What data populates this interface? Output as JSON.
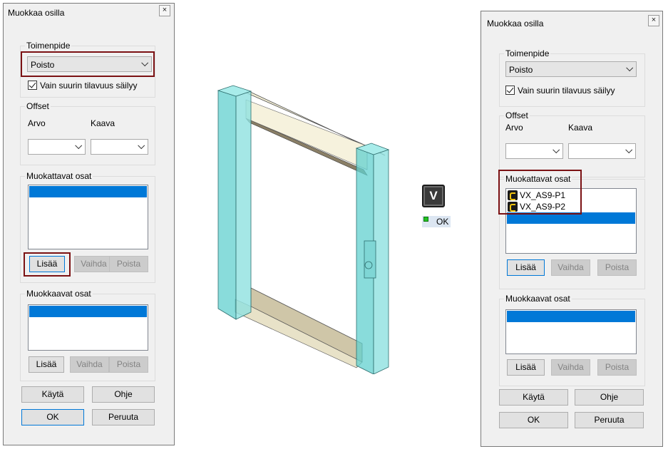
{
  "left_dialog": {
    "title": "Muokkaa osilla",
    "close_label": "×",
    "action_group_label": "Toimenpide",
    "action_value": "Poisto",
    "keep_largest_label": "Vain suurin tilavuus säilyy",
    "offset_group_label": "Offset",
    "value_label": "Arvo",
    "formula_label": "Kaava",
    "modified_parts_label": "Muokattavat osat",
    "modified_parts_items": [],
    "modifying_parts_label": "Muokkaavat osat",
    "add_label": "Lisää",
    "replace_label": "Vaihda",
    "remove_label": "Poista",
    "apply_label": "Käytä",
    "help_label": "Ohje",
    "ok_label": "OK",
    "cancel_label": "Peruuta"
  },
  "center": {
    "v_button_label": "V",
    "ok_badge_label": "OK"
  },
  "right_dialog": {
    "title": "Muokkaa osilla",
    "close_label": "×",
    "action_group_label": "Toimenpide",
    "action_value": "Poisto",
    "keep_largest_label": "Vain suurin tilavuus säilyy",
    "offset_group_label": "Offset",
    "value_label": "Arvo",
    "formula_label": "Kaava",
    "modified_parts_label": "Muokattavat osat",
    "modified_parts_items": [
      {
        "icon": "part-icon",
        "label": "VX_AS9-P1"
      },
      {
        "icon": "part-icon",
        "label": "VX_AS9-P2"
      }
    ],
    "modifying_parts_label": "Muokkaavat osat",
    "add_label": "Lisää",
    "replace_label": "Vaihda",
    "remove_label": "Poista",
    "apply_label": "Käytä",
    "help_label": "Ohje",
    "ok_label": "OK",
    "cancel_label": "Peruuta"
  },
  "colors": {
    "dialog_bg": "#f0f0f0",
    "selection": "#0078d7",
    "highlight": "#7b1113",
    "frame_glass": "#5fd0d0",
    "frame_wood": "#d6ceb0"
  }
}
